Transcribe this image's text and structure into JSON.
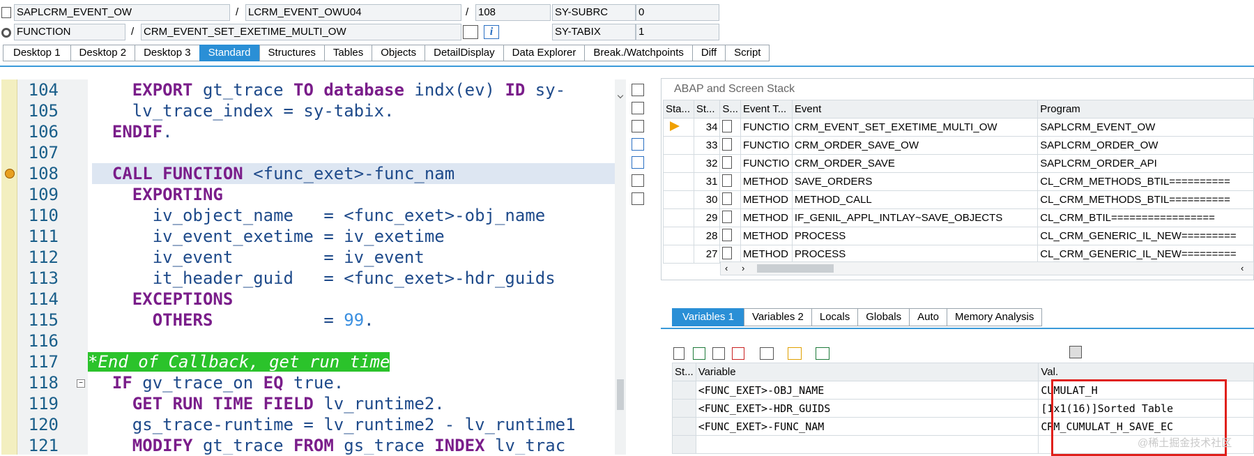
{
  "header": {
    "program": "SAPLCRM_EVENT_OW",
    "include": "LCRM_EVENT_OWU04",
    "line": "108",
    "field1_name": "SY-SUBRC",
    "field1_value": "0",
    "kind": "FUNCTION",
    "name": "CRM_EVENT_SET_EXETIME_MULTI_OW",
    "field2_name": "SY-TABIX",
    "field2_value": "1",
    "slash": "/",
    "info_icon": "i"
  },
  "tabs": [
    "Desktop 1",
    "Desktop 2",
    "Desktop 3",
    "Standard",
    "Structures",
    "Tables",
    "Objects",
    "DetailDisplay",
    "Data Explorer",
    "Break./Watchpoints",
    "Diff",
    "Script"
  ],
  "active_tab": "Standard",
  "editor": {
    "line_numbers": [
      "104",
      "105",
      "106",
      "107",
      "108",
      "109",
      "110",
      "111",
      "112",
      "113",
      "114",
      "115",
      "116",
      "117",
      "118",
      "119",
      "120",
      "121"
    ],
    "lines": {
      "l104a": "    ",
      "l104k1": "EXPORT",
      "l104b": " gt_trace ",
      "l104k2": "TO",
      "l104c": " ",
      "l104k3": "database",
      "l104d": " indx(ev) ",
      "l104k4": "ID",
      "l104e": " sy-",
      "l105": "    lv_trace_index = sy-tabix.",
      "l106k": "ENDIF",
      "l106b": ".",
      "l108k": "CALL FUNCTION",
      "l108b": " <func_exet>-func_nam",
      "l109k": "EXPORTING",
      "l110": "      iv_object_name   = <func_exet>-obj_name",
      "l111": "      iv_event_exetime = iv_exetime",
      "l112": "      iv_event         = iv_event",
      "l113": "      it_header_guid   = <func_exet>-hdr_guids",
      "l114k": "EXCEPTIONS",
      "l115k": "OTHERS",
      "l115b": "           = ",
      "l115n": "99",
      "l115c": ".",
      "l117": "*End of Callback, get run time",
      "l118k1": "IF",
      "l118b": " gv_trace_on ",
      "l118k2": "EQ",
      "l118c": " true.",
      "l119k": "GET RUN TIME FIELD",
      "l119b": " lv_runtime2.",
      "l120": "    gs_trace-runtime = lv_runtime2 - lv_runtime1",
      "l121k1": "MODIFY",
      "l121b": " gt_trace ",
      "l121k2": "FROM",
      "l121c": " gs_trace ",
      "l121k3": "INDEX",
      "l121d": " lv_trac"
    }
  },
  "stack": {
    "title": "ABAP and Screen Stack",
    "columns": [
      "Sta...",
      "St...",
      "S...",
      "Event T...",
      "Event",
      "Program"
    ],
    "rows": [
      {
        "level": "34",
        "type": "FUNCTIO",
        "event": "CRM_EVENT_SET_EXETIME_MULTI_OW",
        "program": "SAPLCRM_EVENT_OW",
        "current": true
      },
      {
        "level": "33",
        "type": "FUNCTIO",
        "event": "CRM_ORDER_SAVE_OW",
        "program": "SAPLCRM_ORDER_OW"
      },
      {
        "level": "32",
        "type": "FUNCTIO",
        "event": "CRM_ORDER_SAVE",
        "program": "SAPLCRM_ORDER_API"
      },
      {
        "level": "31",
        "type": "METHOD",
        "event": "SAVE_ORDERS",
        "program": "CL_CRM_METHODS_BTIL=========="
      },
      {
        "level": "30",
        "type": "METHOD",
        "event": "METHOD_CALL",
        "program": "CL_CRM_METHODS_BTIL=========="
      },
      {
        "level": "29",
        "type": "METHOD",
        "event": "IF_GENIL_APPL_INTLAY~SAVE_OBJECTS",
        "program": "CL_CRM_BTIL================="
      },
      {
        "level": "28",
        "type": "METHOD",
        "event": "PROCESS",
        "program": "CL_CRM_GENERIC_IL_NEW========="
      },
      {
        "level": "27",
        "type": "METHOD",
        "event": "PROCESS",
        "program": "CL_CRM_GENERIC_IL_NEW========="
      }
    ]
  },
  "var_tabs": [
    "Variables 1",
    "Variables 2",
    "Locals",
    "Globals",
    "Auto",
    "Memory Analysis"
  ],
  "active_var_tab": "Variables 1",
  "variables": {
    "columns": [
      "St...",
      "Variable",
      "Val."
    ],
    "rows": [
      {
        "name": "<FUNC_EXET>-OBJ_NAME",
        "value": "CUMULAT_H"
      },
      {
        "name": "<FUNC_EXET>-HDR_GUIDS",
        "value": "[1x1(16)]Sorted Table"
      },
      {
        "name": "<FUNC_EXET>-FUNC_NAM",
        "value": "CRM_CUMULAT_H_SAVE_EC"
      }
    ]
  },
  "watermark": "@稀土掘金技术社区",
  "colors": {
    "accent": "#2a8fd6",
    "highlight_box": "#e0201b",
    "comment_bg": "#2bc32b",
    "keyword": "#7a1d8a"
  }
}
